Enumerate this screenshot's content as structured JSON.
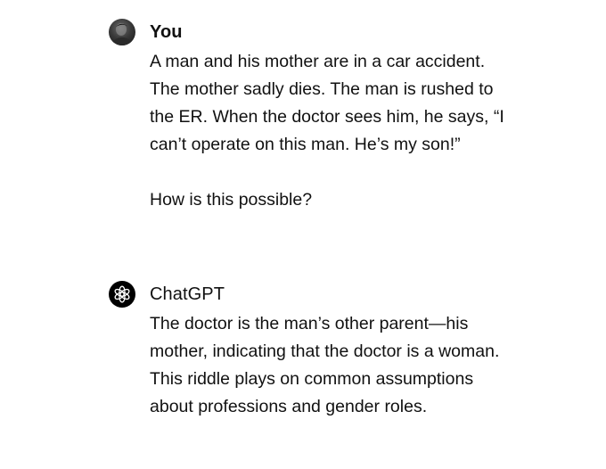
{
  "conversation": {
    "user_message": {
      "author": "You",
      "avatar_icon": "user-photo-avatar",
      "paragraphs": [
        "A man and his mother are in a car accident. The mother sadly dies. The man is rushed to the ER. When the doctor sees him, he says, “I can’t operate on this man. He’s my son!”",
        "How is this possible?"
      ]
    },
    "assistant_message": {
      "author": "ChatGPT",
      "avatar_icon": "openai-logo-icon",
      "paragraphs": [
        "The doctor is the man’s other parent—his mother, indicating that the doctor is a woman. This riddle plays on common assumptions about professions and gender roles."
      ]
    }
  }
}
